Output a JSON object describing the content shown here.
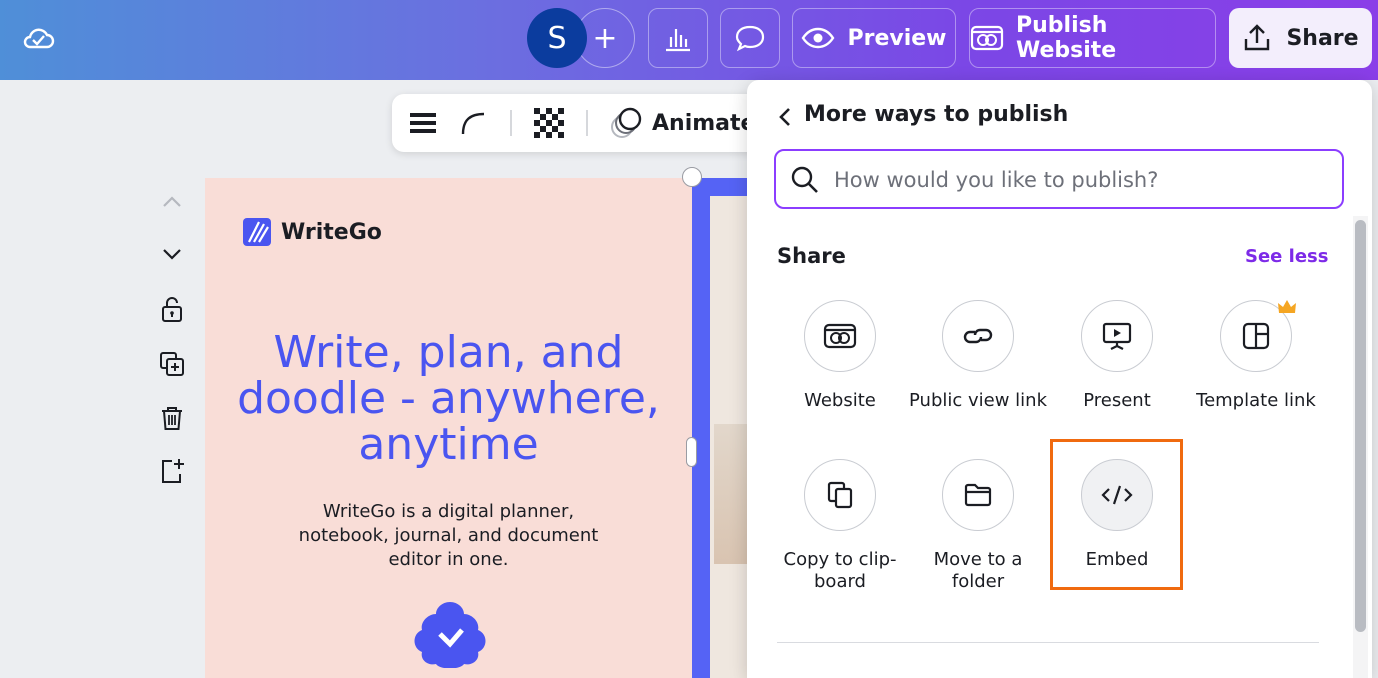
{
  "topbar": {
    "avatar_letter": "S",
    "add_symbol": "+",
    "preview_label": "Preview",
    "publish_label": "Publish Website",
    "share_label": "Share"
  },
  "toolbar": {
    "animate_label": "Animate"
  },
  "page": {
    "brand_name": "WriteGo",
    "headline": "Write, plan, and doodle - anywhere, anytime",
    "subtext": "WriteGo is a digital planner, notebook, journal, and document editor in one."
  },
  "panel": {
    "title": "More ways to publish",
    "search_placeholder": "How would you like to publish?",
    "search_value": "",
    "section_title": "Share",
    "see_less_label": "See less",
    "options": [
      {
        "label": "Website",
        "icon": "website-icon"
      },
      {
        "label": "Public view link",
        "icon": "link-icon"
      },
      {
        "label": "Present",
        "icon": "present-icon"
      },
      {
        "label": "Template link",
        "icon": "template-icon",
        "premium": true
      },
      {
        "label": "Copy to clip-board",
        "icon": "copy-icon"
      },
      {
        "label": "Move to a folder",
        "icon": "folder-icon"
      },
      {
        "label": "Embed",
        "icon": "embed-icon",
        "highlighted": true
      }
    ]
  },
  "colors": {
    "accent": "#8b3dff",
    "headline": "#4a55f0",
    "highlight": "#f06a0f"
  }
}
